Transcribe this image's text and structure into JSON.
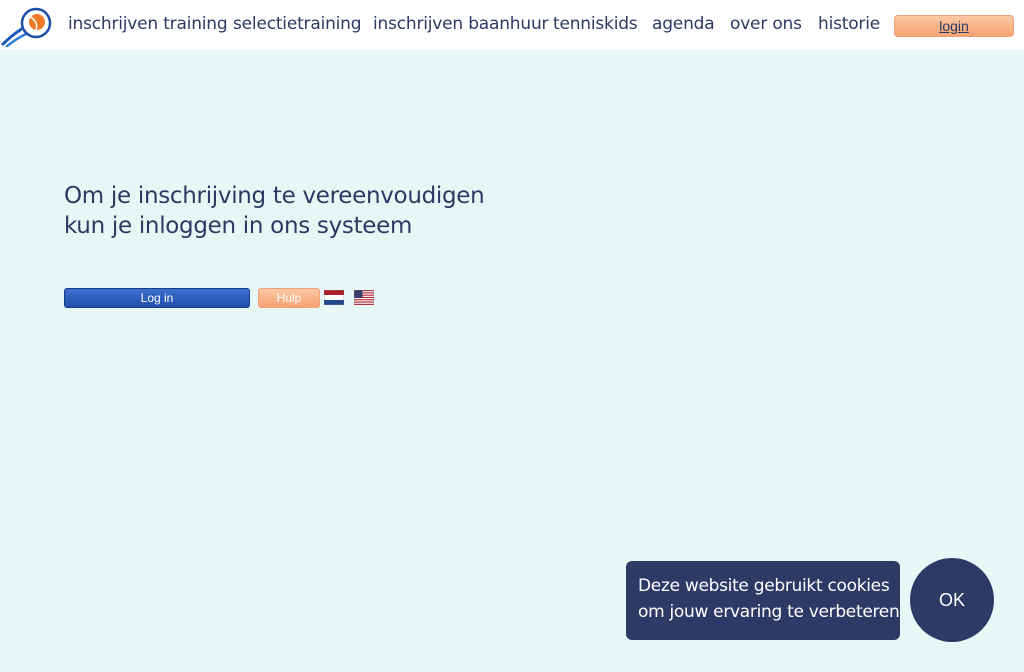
{
  "nav": {
    "items": [
      {
        "label": "inschrijven training"
      },
      {
        "label": "selectietraining"
      },
      {
        "label": "inschrijven baanhuur"
      },
      {
        "label": "tenniskids"
      },
      {
        "label": "agenda"
      },
      {
        "label": "over ons"
      },
      {
        "label": "historie"
      }
    ],
    "login_label": "login"
  },
  "intro": {
    "line1": "Om je inschrijving te vereenvoudigen",
    "line2": "kun je inloggen in ons systeem"
  },
  "actions": {
    "login_label": "Log in",
    "help_label": "Hulp"
  },
  "language_flags": [
    "dutch-flag-icon",
    "us-flag-icon"
  ],
  "cookie": {
    "line1": "Deze website gebruikt cookies",
    "line2": "om jouw ervaring te verbeteren",
    "ok_label": "OK"
  },
  "colors": {
    "background": "#e6f7f6",
    "text": "#2c3a63",
    "accent_orange": "#f6a371",
    "primary_blue": "#1e4ea8",
    "cookie_bg": "#2e3a66"
  }
}
